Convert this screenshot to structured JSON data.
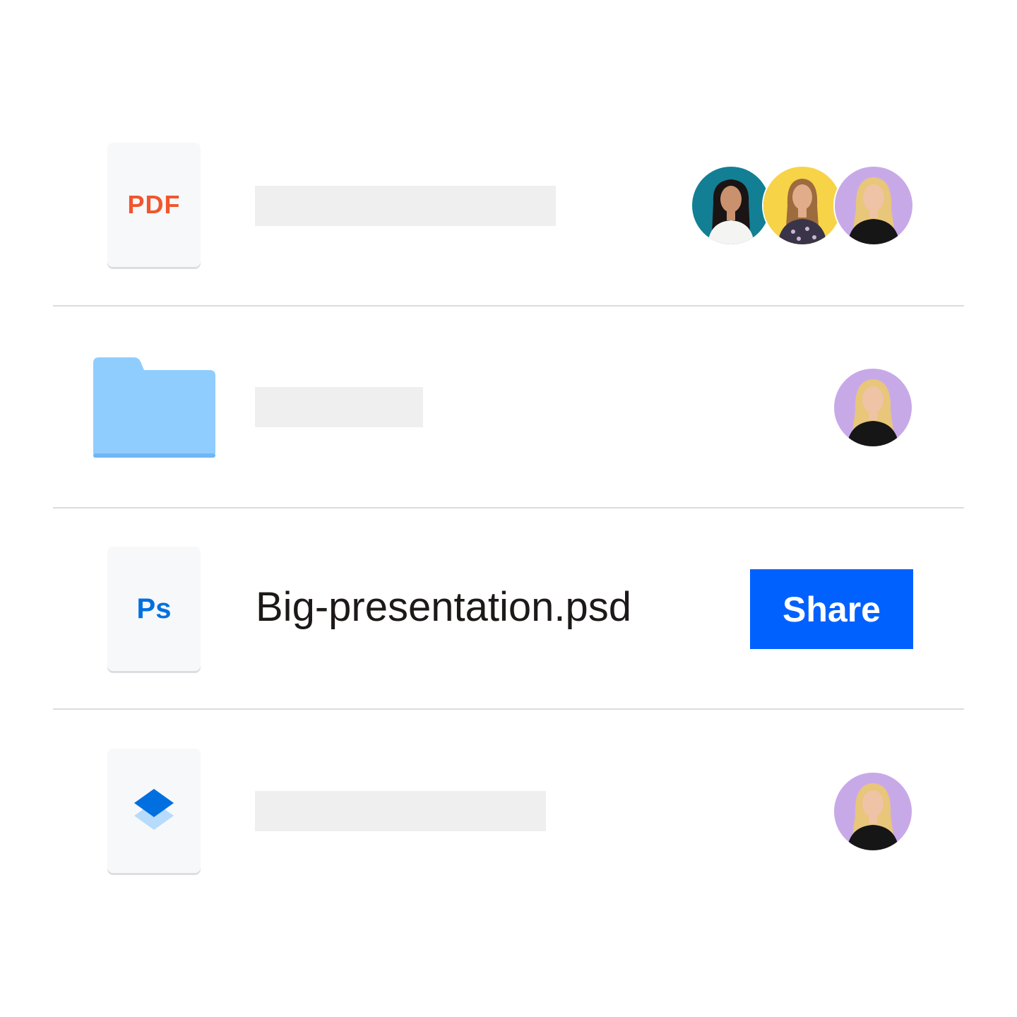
{
  "colors": {
    "pdf_label": "#f0562e",
    "ps_label": "#0070e0",
    "folder": "#90cdff",
    "share_button": "#0061fe",
    "avatar_teal": "#137f94",
    "avatar_yellow": "#f7d347",
    "avatar_lavender": "#c8a9e8"
  },
  "files": [
    {
      "type_label": "PDF",
      "icon": "pdf-file-icon",
      "collaborators": [
        "avatar-teal",
        "avatar-yellow",
        "avatar-lavender"
      ]
    },
    {
      "icon": "folder-icon",
      "collaborators": [
        "avatar-lavender"
      ]
    },
    {
      "type_label": "Ps",
      "icon": "photoshop-file-icon",
      "name": "Big-presentation.psd",
      "action_label": "Share"
    },
    {
      "icon": "layers-file-icon",
      "collaborators": [
        "avatar-lavender"
      ]
    }
  ]
}
